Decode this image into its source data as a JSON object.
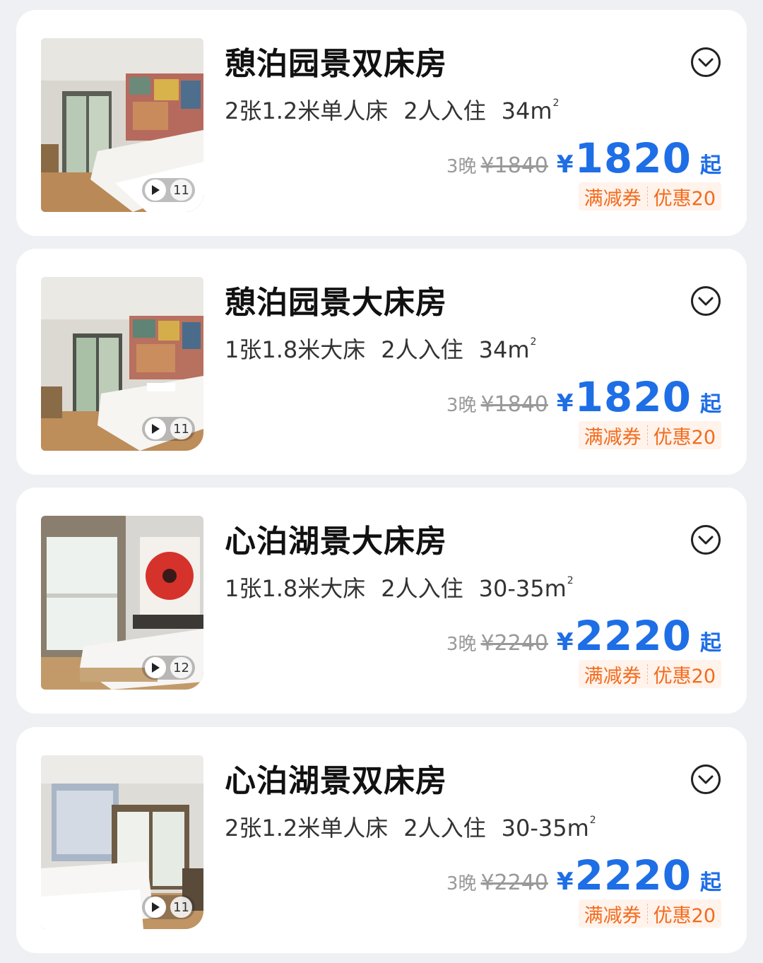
{
  "accent": "#1e6ee6",
  "promo_color": "#f26b1d",
  "rooms": [
    {
      "title": "憩泊园景双床房",
      "bed": "2张1.2米单人床",
      "guests": "2人入住",
      "area": "34m",
      "area_unit_sup": "2",
      "photo_count": "11",
      "nights": "3晚",
      "original_price": "¥1840",
      "currency": "¥",
      "price": "1820",
      "from_label": "起",
      "promo_tag": "满减券",
      "promo_value": "优惠20",
      "icons": [
        "play-icon",
        "chevron-down-icon"
      ]
    },
    {
      "title": "憩泊园景大床房",
      "bed": "1张1.8米大床",
      "guests": "2人入住",
      "area": "34m",
      "area_unit_sup": "2",
      "photo_count": "11",
      "nights": "3晚",
      "original_price": "¥1840",
      "currency": "¥",
      "price": "1820",
      "from_label": "起",
      "promo_tag": "满减券",
      "promo_value": "优惠20",
      "icons": [
        "play-icon",
        "chevron-down-icon"
      ]
    },
    {
      "title": "心泊湖景大床房",
      "bed": "1张1.8米大床",
      "guests": "2人入住",
      "area": "30-35m",
      "area_unit_sup": "2",
      "photo_count": "12",
      "nights": "3晚",
      "original_price": "¥2240",
      "currency": "¥",
      "price": "2220",
      "from_label": "起",
      "promo_tag": "满减券",
      "promo_value": "优惠20",
      "icons": [
        "play-icon",
        "chevron-down-icon"
      ]
    },
    {
      "title": "心泊湖景双床房",
      "bed": "2张1.2米单人床",
      "guests": "2人入住",
      "area": "30-35m",
      "area_unit_sup": "2",
      "photo_count": "11",
      "nights": "3晚",
      "original_price": "¥2240",
      "currency": "¥",
      "price": "2220",
      "from_label": "起",
      "promo_tag": "满减券",
      "promo_value": "优惠20",
      "icons": [
        "play-icon",
        "chevron-down-icon"
      ]
    }
  ]
}
